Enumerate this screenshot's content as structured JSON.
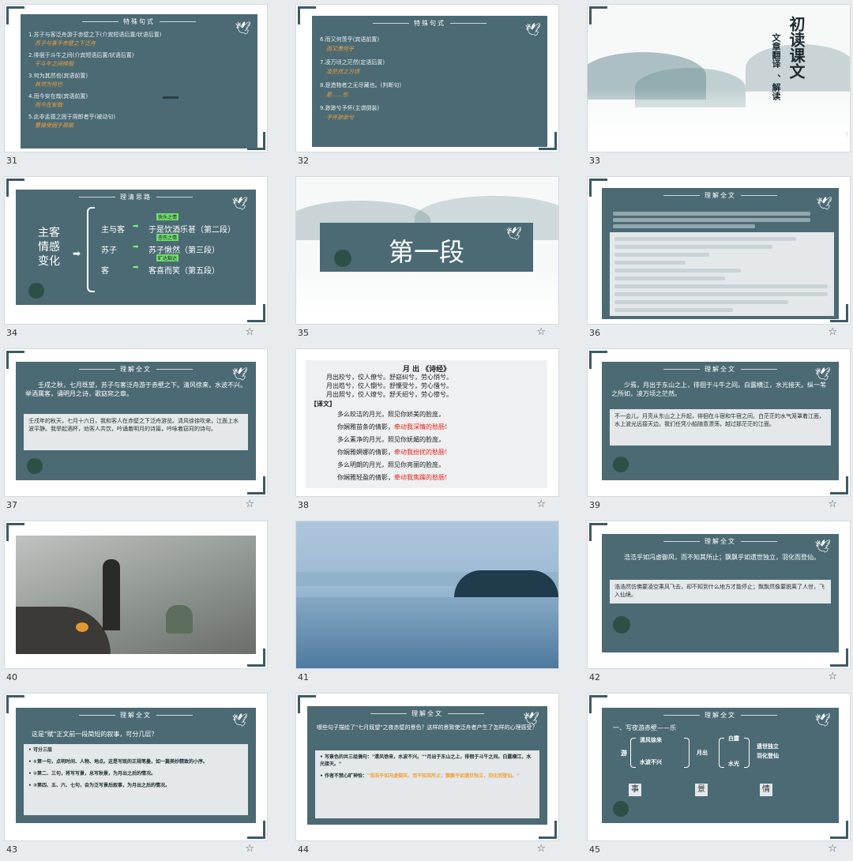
{
  "slides": [
    {
      "num": "31",
      "title": "特殊句式",
      "items": [
        {
          "t": "1.苏子与客泛舟游于赤壁之下(介宾短语后置/状语后置)",
          "a": "苏子与客于赤壁之下泛舟"
        },
        {
          "t": "2.徘徊于斗牛之间(介宾短语后置/状语后置)",
          "a": "于斗牛之间徘徊"
        },
        {
          "t": "3.何为其然也(宾语前置)",
          "a": "其然为何也"
        },
        {
          "t": "4.而今安在哉(宾语前置)",
          "a": "而今在安哉"
        },
        {
          "t": "5.此非孟德之困于周郎者乎(被动句)",
          "a": "曹操受困于周瑜"
        }
      ]
    },
    {
      "num": "32",
      "title": "特殊句式",
      "items": [
        {
          "t": "6.而又何羡乎(宾语前置)",
          "a": "而又羡何乎"
        },
        {
          "t": "7.凌万顷之茫然(定语后置)",
          "a": "凌茫然之万顷"
        },
        {
          "t": "8.是造物者之无尽藏也。(判断句)",
          "a": "是......也"
        },
        {
          "t": "9.渺渺兮予怀(主谓倒装)",
          "a": "予怀渺渺兮"
        }
      ]
    },
    {
      "num": "33",
      "heading": "初读课文",
      "sub1": "文章翻译",
      "sub2": "、解读"
    },
    {
      "num": "34",
      "title": "理清思路",
      "left": "主客情感变化",
      "r1a": "主与客",
      "r1b": "于是饮酒乐甚（第二段）",
      "r2a": "苏子",
      "r2b": "苏子愀然（第三段）",
      "r3a": "客",
      "r3b": "客喜而笑（第五段）",
      "tag1": "快乐之情",
      "tag2": "悲伤之情",
      "tag3": "旷达豁达"
    },
    {
      "num": "35",
      "heading": "第一段"
    },
    {
      "num": "36",
      "title": "理解全文"
    },
    {
      "num": "37",
      "title": "理解全文",
      "text": "壬戌之秋，七月既望，苏子与客泛舟游于赤壁之下。清风徐来，水波不兴。举酒属客，诵明月之诗，歌窈窕之章。",
      "trans": "壬戌年的秋天，七月十六日，我和客人在赤壁之下泛舟游览。清风徐徐吹来，江面上水波平静。我举起酒杯，劝客人共饮，吟诵着明月的诗篇，吟咏着窈窕的诗句。"
    },
    {
      "num": "38",
      "poem_title": "月 出 《诗经》",
      "lines": [
        "月出皎兮，佼人僚兮。舒窈纠兮，劳心悄兮。",
        "月出皓兮，佼人懰兮。舒懮受兮，劳心慅兮。",
        "月出照兮，佼人燎兮。舒夭绍兮，劳心惨兮。"
      ],
      "trans_label": "【译文】",
      "tl": [
        {
          "a": "多么皎洁的月光，照见你娇美的脸庞，",
          "b": ""
        },
        {
          "a": "你娴雅苗条的倩影，",
          "b": "牵动我深情的愁肠!"
        },
        {
          "a": "多么素净的月光，照见你妩媚的脸庞，",
          "b": ""
        },
        {
          "a": "你娴雅婀娜的倩影，",
          "b": "牵动我纷扰的愁肠!"
        },
        {
          "a": "多么明朗的月光，照见你亮丽的脸庞，",
          "b": ""
        },
        {
          "a": "你娴雅轻盈的倩影，",
          "b": "牵动我焦躁的愁肠!"
        }
      ]
    },
    {
      "num": "39",
      "title": "理解全文",
      "text": "少焉，月出于东山之上，徘徊于斗牛之间。白露横江，水光接天。纵一苇之所如，凌万顷之茫然。",
      "trans": "不一会儿，月亮从东山之上升起，徘徊在斗宿和牛宿之间。白茫茫的水气笼罩着江面，水上波光远接天边。我们任凭小船随意漂荡，越过那茫茫的江面。"
    },
    {
      "num": "40"
    },
    {
      "num": "41"
    },
    {
      "num": "42",
      "title": "理解全文",
      "text": "浩浩乎如冯虚御风，而不知其所止；飘飘乎如遗世独立，羽化而登仙。",
      "trans": "浩浩然仿佛要凌空乘风飞去，却不知到什么地方才能停止；飘飘然像要脱离了人世，飞入仙境。"
    },
    {
      "num": "43",
      "title": "理解全文",
      "q": "这是\"赋\"正文前一段简短的叙事，可分几层？",
      "items": [
        "可分三层",
        "①第一句，点明时间、人物、地点。这是写既的正规笔墨，如一篇美妙精致的小序。",
        "②第二、三句，将写写景，总写秋景，为月出之后的情况。",
        "③第四、五、六、七句，会为泛写景后叙事，为月出之后的情况。"
      ]
    },
    {
      "num": "44",
      "title": "理解全文",
      "q": "哪些句子描绘了\"七月既望\"之夜赤壁的景色？这样的景致使泛舟者产生了怎样的心理感受？",
      "b1": "写景色的共三组偶句：\"清风徐来，水波不兴。\"\"月出于东山之上，徘徊于斗牛之间。白露横江，水光接天。\"",
      "b2": "作者不禁心旷神怡：",
      "b2o": "\"浩浩乎如冯虚御风，而不知其所止；飘飘乎如遗世独立，羽化而登仙。\""
    },
    {
      "num": "45",
      "title": "理解全文",
      "head": "一、写夜游赤壁——乐",
      "you": "游",
      "f1": "清风徐来",
      "f2": "水波不兴",
      "yue": "月出",
      "b1": "白露",
      "b2": "水光",
      "c1": "遗世独立",
      "c2": "羽化登仙",
      "k1": "事",
      "k2": "景",
      "k3": "情"
    }
  ]
}
